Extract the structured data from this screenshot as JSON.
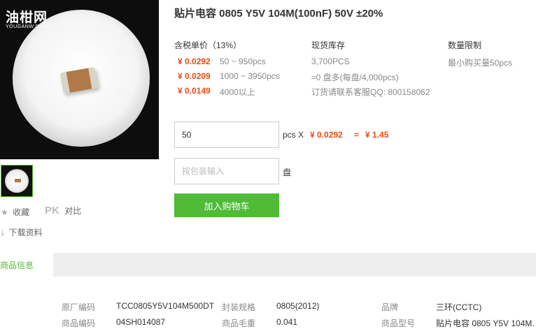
{
  "brand_logo": {
    "text": "油柑网",
    "sub": "YOUGANW.COM"
  },
  "product": {
    "title": "贴片电容 0805 Y5V 104M(100nF) 50V ±20%"
  },
  "price_section": {
    "header": "含税单价（13%）",
    "tiers": [
      {
        "price": "¥ 0.0292",
        "range": "50 ~ 950pcs"
      },
      {
        "price": "¥ 0.0209",
        "range": "1000 ~ 3950pcs"
      },
      {
        "price": "¥ 0.0149",
        "range": "4000以上"
      }
    ]
  },
  "stock_section": {
    "header": "现货库存",
    "quantity": "3,700PCS",
    "reels": "≈0 盘多(每盘/4,000pcs)",
    "contact": "订货请联系客服QQ: 800158062"
  },
  "limit_section": {
    "header": "数量限制",
    "text": "最小购买量50pcs"
  },
  "order": {
    "qty_value": "50",
    "unit": "pcs X",
    "unit_price": "¥ 0.0292",
    "equals": "=",
    "total": "¥ 1.45",
    "pkg_placeholder": "按包装输入",
    "pkg_unit": "盘",
    "add_to_cart": "加入购物车"
  },
  "actions": {
    "favorite_icon": "star-icon",
    "favorite": "收藏",
    "pk": "PK",
    "compare": "对比",
    "download_icon": "download-icon",
    "download": "下载资料"
  },
  "tabs": [
    {
      "label": "商品信息",
      "active": true
    }
  ],
  "info_rows": [
    {
      "k1": "原厂编码",
      "v1": "TCC0805Y5V104M500DT",
      "k2": "封装规格",
      "v2": "0805(2012)",
      "k3": "品牌",
      "v3": "三环(CCTC)"
    },
    {
      "k1": "商品编码",
      "v1": "04SH014087",
      "k2": "商品毛重",
      "v2": "0.041",
      "k3": "商品型号",
      "v3": "贴片电容 0805 Y5V 104M."
    }
  ],
  "colors": {
    "accent": "#4fbb36",
    "price": "#e94c14"
  }
}
